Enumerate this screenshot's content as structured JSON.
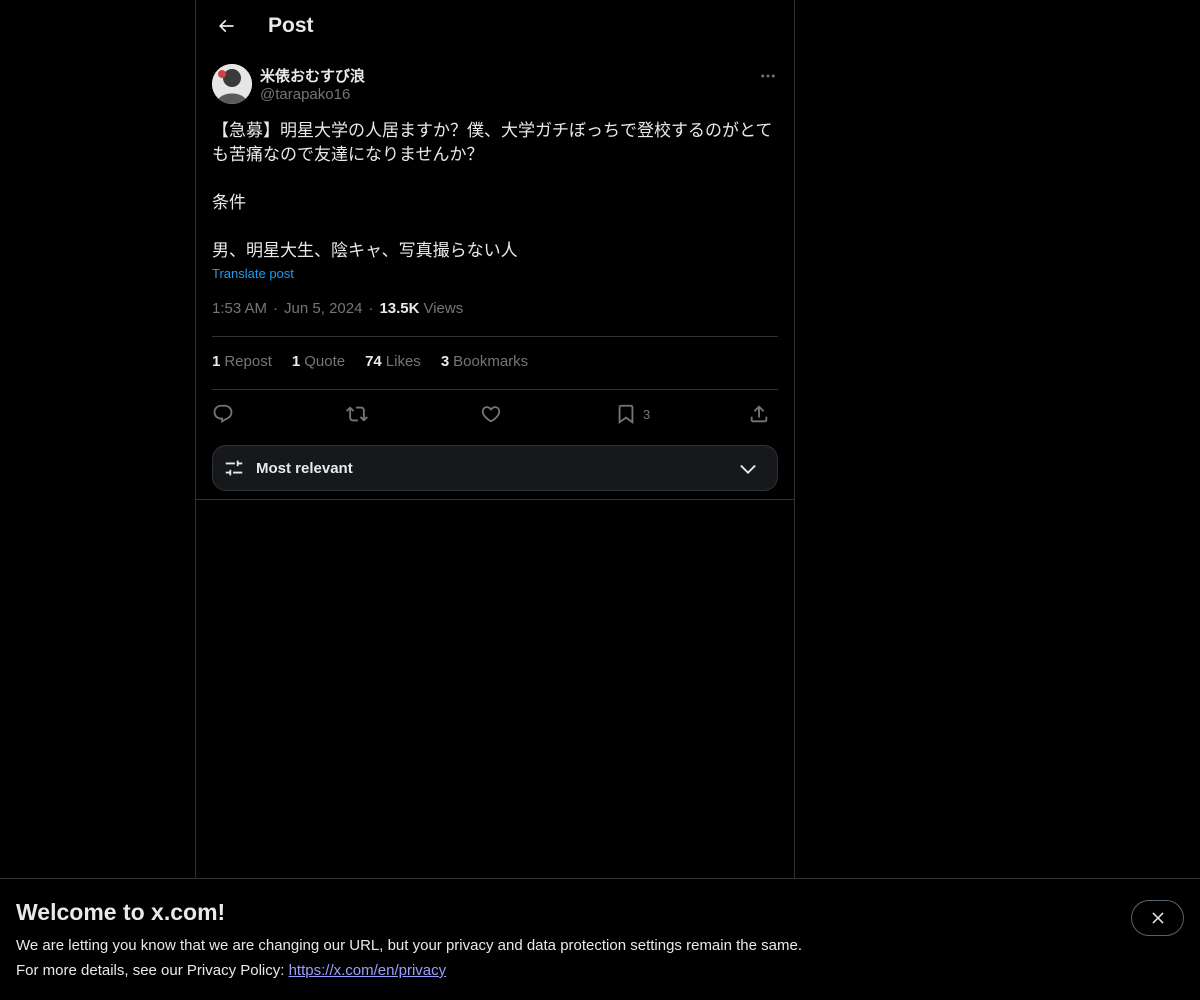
{
  "header": {
    "title": "Post"
  },
  "author": {
    "display_name": "米俵おむすび浪",
    "handle": "@tarapako16"
  },
  "tweet": {
    "text": "【急募】明星大学の人居ますか？僕、大学ガチぼっちで登校するのがとても苦痛なので友達になりませんか？\n\n条件\n\n男、明星大生、陰キャ、写真撮らない人",
    "translate_label": "Translate post",
    "time": "1:53 AM",
    "date": "Jun 5, 2024",
    "views_count": "13.5K",
    "views_label": "Views"
  },
  "stats": {
    "reposts_count": "1",
    "reposts_label": "Repost",
    "quotes_count": "1",
    "quotes_label": "Quote",
    "likes_count": "74",
    "likes_label": "Likes",
    "bookmarks_count": "3",
    "bookmarks_label": "Bookmarks"
  },
  "actions": {
    "bookmark_count": "3"
  },
  "sort": {
    "label": "Most relevant"
  },
  "banner": {
    "title": "Welcome to x.com!",
    "line1": "We are letting you know that we are changing our URL, but your privacy and data protection settings remain the same.",
    "line2_prefix": "For more details, see our Privacy Policy: ",
    "link": "https://x.com/en/privacy"
  },
  "colors": {
    "accent": "#1d9bf0",
    "muted": "#71767b",
    "text": "#e7e9ea",
    "border": "#2f3336"
  },
  "icons": [
    "back-arrow-icon",
    "more-icon",
    "reply-icon",
    "repost-icon",
    "like-icon",
    "bookmark-icon",
    "share-icon",
    "sliders-icon",
    "chevron-down-icon",
    "close-icon"
  ]
}
